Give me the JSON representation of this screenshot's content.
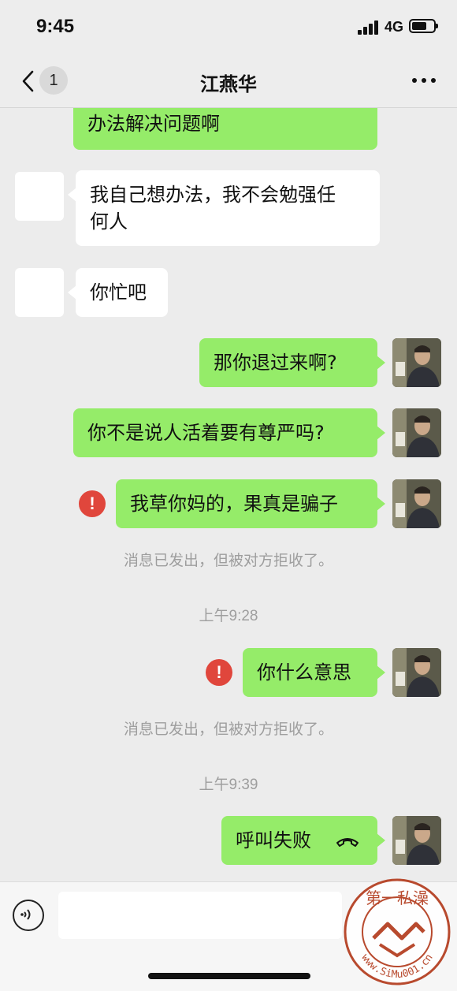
{
  "status_bar": {
    "time": "9:45",
    "network": "4G",
    "battery_level": 0.6
  },
  "nav": {
    "unread_count": "1",
    "title": "江燕华",
    "back_icon": "chevron-left-icon",
    "more_icon": "ellipsis-icon"
  },
  "messages": [
    {
      "direction": "out",
      "text": "办法解决问题啊",
      "partial": true
    },
    {
      "direction": "in",
      "lines": [
        "我自己想办法，我不会勉强任",
        "何人"
      ]
    },
    {
      "direction": "in",
      "text": "你忙吧"
    },
    {
      "direction": "out",
      "text": "那你退过来啊?"
    },
    {
      "direction": "out",
      "text": "你不是说人活着要有尊严吗?"
    },
    {
      "direction": "out",
      "text": "我草你妈的，果真是骗子",
      "failed": true
    },
    {
      "type": "system",
      "text": "消息已发出，但被对方拒收了。"
    },
    {
      "type": "time",
      "text": "上午9:28"
    },
    {
      "direction": "out",
      "text": "你什么意思",
      "failed": true
    },
    {
      "type": "system",
      "text": "消息已发出，但被对方拒收了。"
    },
    {
      "type": "time",
      "text": "上午9:39"
    },
    {
      "direction": "out",
      "text": "呼叫失败",
      "icon": "phone-hangup-icon"
    }
  ],
  "error_glyph": "!",
  "colors": {
    "bubble_out": "#95ec69",
    "bubble_in": "#ffffff",
    "background": "#ececec",
    "error": "#e0463c"
  },
  "input_bar": {
    "voice_icon": "voice-icon",
    "placeholder": ""
  },
  "watermark": {
    "text": "第一私澡",
    "url": "www.SiMu001.cn"
  }
}
